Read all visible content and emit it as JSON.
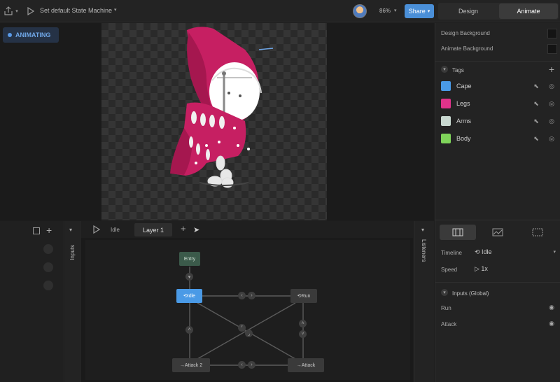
{
  "topbar": {
    "state_machine_title": "Set default State Machine",
    "zoom": "86%",
    "share_label": "Share",
    "design_label": "Design",
    "animate_label": "Animate"
  },
  "stage": {
    "badge_label": "ANIMATING"
  },
  "right_panel": {
    "design_background_label": "Design Background",
    "animate_background_label": "Animate Background",
    "tags_title": "Tags",
    "tags": [
      {
        "name": "Cape",
        "color": "#4a9ae6"
      },
      {
        "name": "Legs",
        "color": "#e0338a"
      },
      {
        "name": "Arms",
        "color": "#c8d8d0"
      },
      {
        "name": "Body",
        "color": "#7fd45a"
      }
    ],
    "timeline_label": "Timeline",
    "timeline_value": "Idle",
    "speed_label": "Speed",
    "speed_value": "1x",
    "inputs_section_title": "Inputs (Global)",
    "inputs": [
      {
        "name": "Run"
      },
      {
        "name": "Attack"
      }
    ]
  },
  "bottom": {
    "inputs_tab_label": "Inputs",
    "listeners_tab_label": "Listeners",
    "tabs": [
      "Idle",
      "Layer 1"
    ],
    "nodes": {
      "entry": "Entry",
      "idle": "Idle",
      "run": "Run",
      "attack2": "Attack 2",
      "attack": "Attack"
    }
  },
  "colors": {
    "accent": "#4a8fd8",
    "node_idle": "#4a9ae6",
    "node_entry": "#3b5a4a",
    "character_red": "#c61f62"
  }
}
